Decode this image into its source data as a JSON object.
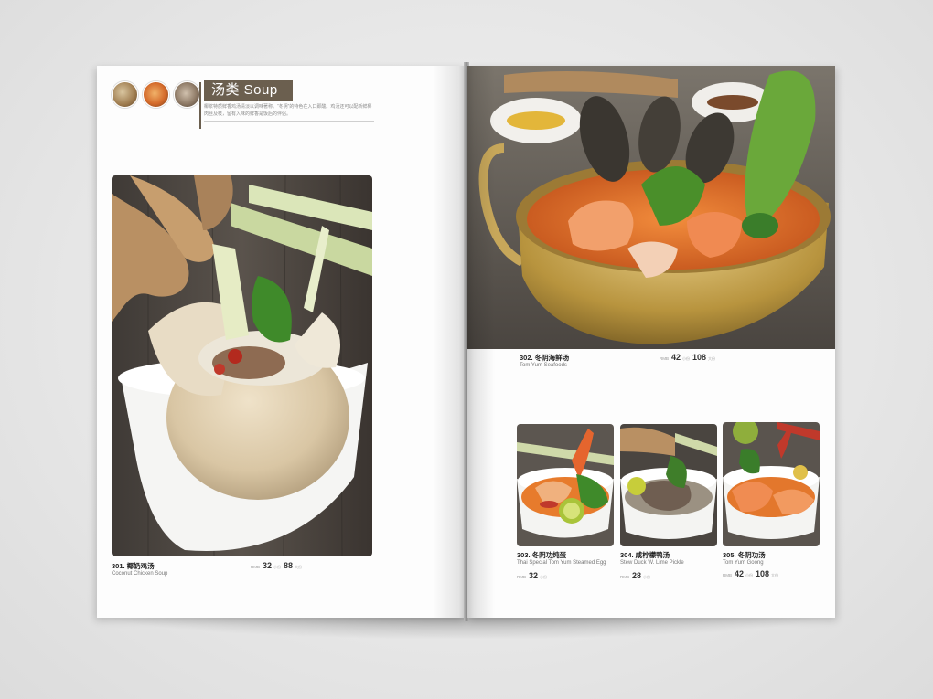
{
  "header": {
    "title": "汤类 Soup",
    "intro_line1": "椰浆特质鲜香鸡汤清淡以调味著称。“冬阴”的特色在入口即酸。鸡汤还可以配新鲜椰",
    "intro_line2": "肉丝及枝，留有入味的鲜香是饭后的伴侣。"
  },
  "dishes": [
    {
      "code": "301. 椰奶鸡汤",
      "en": "Coconut Chicken Soup",
      "currency": "RMB",
      "price_small": "32",
      "small_label": "小份",
      "price_large": "88",
      "large_label": "大份"
    },
    {
      "code": "302. 冬阴海鲜汤",
      "en": "Tom Yum Seafoods",
      "currency": "RMB",
      "price_small": "42",
      "small_label": "小份",
      "price_large": "108",
      "large_label": "大份"
    },
    {
      "code": "303. 冬阴功炖蛋",
      "en": "Thai Special Tom Yum Steamed Egg",
      "currency": "RMB",
      "price_small": "32",
      "small_label": "小份"
    },
    {
      "code": "304. 咸柠檬鸭汤",
      "en": "Stew Duck W. Lime Pickle",
      "currency": "RMB",
      "price_small": "28",
      "small_label": "小份"
    },
    {
      "code": "305. 冬阴功汤",
      "en": "Tom Yum Goong",
      "currency": "RMB",
      "price_small": "42",
      "small_label": "小份",
      "price_large": "108",
      "large_label": "大份"
    }
  ],
  "colors": {
    "title_bg": "#6b5f4f",
    "page": "#fdfdfd",
    "soup_orange": "#e0772e"
  }
}
